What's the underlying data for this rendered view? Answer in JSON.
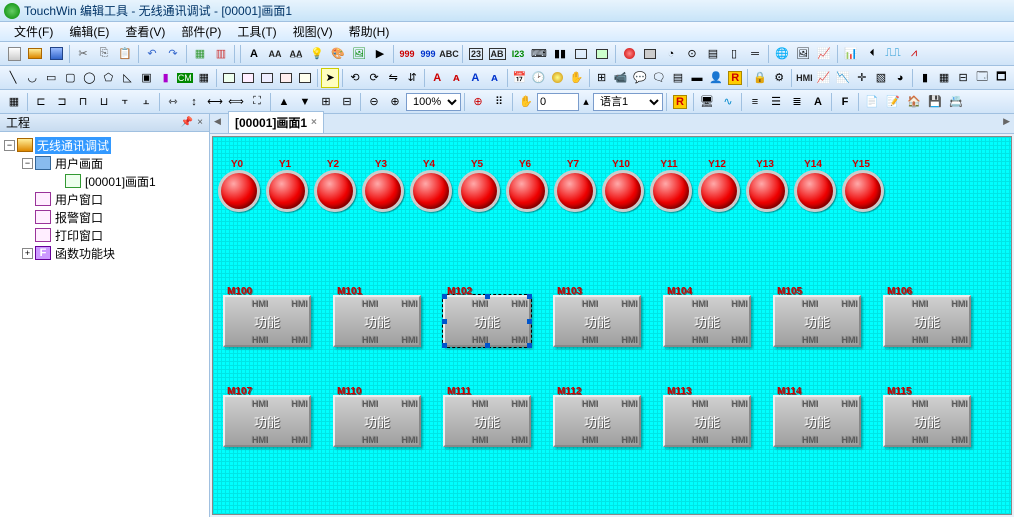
{
  "title": "TouchWin 编辑工具 - 无线通讯调试 - [00001]画面1",
  "menus": [
    "文件(F)",
    "编辑(E)",
    "查看(V)",
    "部件(P)",
    "工具(T)",
    "视图(V)",
    "帮助(H)"
  ],
  "sidebar": {
    "title": "工程",
    "pin": "📌",
    "close": "×",
    "nodes": {
      "root": "无线通讯调试",
      "userScreens": "用户画面",
      "screen1": "[00001]画面1",
      "userWin": "用户窗口",
      "alarmWin": "报警窗口",
      "printWin": "打印窗口",
      "funcBlock": "函数功能块"
    }
  },
  "docTab": "[00001]画面1",
  "zoom": "100%",
  "spinValue": "0",
  "langLabel": "语言1",
  "lamps": [
    "Y0",
    "Y1",
    "Y2",
    "Y3",
    "Y4",
    "Y5",
    "Y6",
    "Y7",
    "Y10",
    "Y11",
    "Y12",
    "Y13",
    "Y14",
    "Y15"
  ],
  "btnRow1": [
    {
      "tag": "M100",
      "label": "功能"
    },
    {
      "tag": "M101",
      "label": "功能"
    },
    {
      "tag": "M102",
      "label": "功能"
    },
    {
      "tag": "M103",
      "label": "功能"
    },
    {
      "tag": "M104",
      "label": "功能"
    },
    {
      "tag": "M105",
      "label": "功能"
    },
    {
      "tag": "M106",
      "label": "功能"
    }
  ],
  "btnRow2": [
    {
      "tag": "M107",
      "label": "功能"
    },
    {
      "tag": "M110",
      "label": "功能"
    },
    {
      "tag": "M111",
      "label": "功能"
    },
    {
      "tag": "M112",
      "label": "功能"
    },
    {
      "tag": "M113",
      "label": "功能"
    },
    {
      "tag": "M114",
      "label": "功能"
    },
    {
      "tag": "M115",
      "label": "功能"
    }
  ],
  "watermark": "HMI",
  "funcIcon": "F"
}
